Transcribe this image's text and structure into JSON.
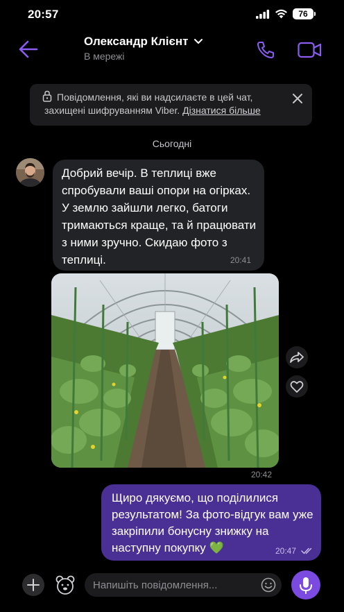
{
  "status_bar": {
    "time": "20:57",
    "battery": "76"
  },
  "header": {
    "contact_name": "Олександр Клієнт",
    "contact_status": "В мережі"
  },
  "encryption_banner": {
    "text": "Повідомлення, які ви надсилаєте в цей чат, захищені шифруванням Viber.",
    "link": "Дізнатися більше"
  },
  "date_separator": "Сьогодні",
  "messages": [
    {
      "direction": "incoming",
      "type": "text",
      "text": "Добрий вечір. В теплиці вже спробували ваші опори на огірках. У землю зайшли легко, батоги тримаються краще, та й працювати з ними зручно. Скидаю фото з теплиці.",
      "time": "20:41"
    },
    {
      "direction": "incoming",
      "type": "photo",
      "time": "20:42"
    },
    {
      "direction": "outgoing",
      "type": "text",
      "text": "Щиро дякуємо, що поділилися результатом! За фото-відгук вам уже закріпили бонусну знижку на наступну покупку 💚",
      "time": "20:47"
    }
  ],
  "composer": {
    "placeholder": "Напишіть повідомлення..."
  },
  "colors": {
    "accent": "#8a5cf0",
    "outgoing_bubble": "#4a2f94",
    "incoming_bubble": "#222326",
    "mic_button": "#7b4ae0"
  },
  "icons": [
    "back-arrow-icon",
    "chevron-down-icon",
    "phone-icon",
    "video-camera-icon",
    "lock-icon",
    "close-icon",
    "forward-icon",
    "heart-icon",
    "plus-icon",
    "sticker-bear-icon",
    "emoji-icon",
    "microphone-icon",
    "read-checkmarks-icon"
  ]
}
